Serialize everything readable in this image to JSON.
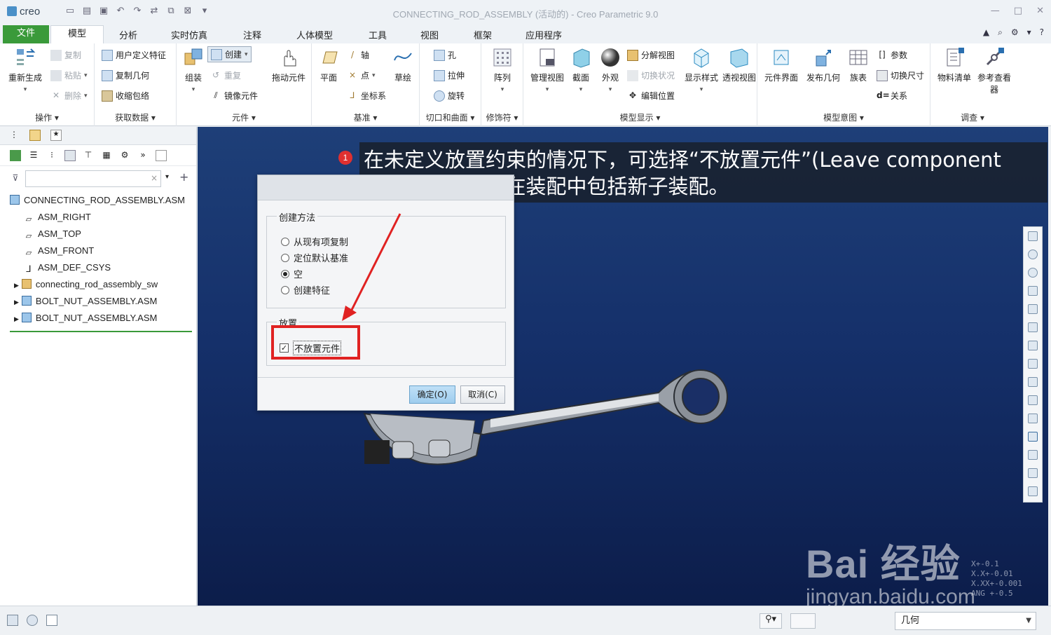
{
  "app": {
    "logo": "creo",
    "window_title": "CONNECTING_ROD_ASSEMBLY (活动的) - Creo Parametric 9.0"
  },
  "tabs": [
    "文件",
    "模型",
    "分析",
    "实时仿真",
    "注释",
    "人体模型",
    "工具",
    "视图",
    "框架",
    "应用程序"
  ],
  "ribbon": {
    "groups": {
      "operations": "操作",
      "get_data": "获取数据",
      "component": "元件",
      "datum": "基准",
      "cut_surface": "切口和曲面",
      "modifier": "修饰符",
      "model_display": "模型显示",
      "model_intent": "模型意图",
      "investigate": "调查"
    },
    "regenerate": "重新生成",
    "copy": "复制",
    "paste": "粘贴",
    "delete": "删除",
    "user_defined_feature": "用户定义特征",
    "copy_geometry": "复制几何",
    "shrinkwrap": "收缩包络",
    "assemble": "组装",
    "create": "创建",
    "repeat": "重复",
    "mirror_component": "镜像元件",
    "drag_components": "拖动元件",
    "plane": "平面",
    "axis": "轴",
    "point": "点",
    "csys": "坐标系",
    "sketch": "草绘",
    "hole": "孔",
    "extrude": "拉伸",
    "revolve": "旋转",
    "pattern": "阵列",
    "manage_views": "管理视图",
    "section": "截面",
    "appearance": "外观",
    "exploded_view": "分解视图",
    "toggle_status": "切换状况",
    "edit_position": "编辑位置",
    "display_style": "显示样式",
    "perspective_view": "透视视图",
    "component_interface": "元件界面",
    "publish_geometry": "发布几何",
    "family_table": "族表",
    "parameters": "参数",
    "switch_dimensions": "切换尺寸",
    "relations": "关系",
    "bill_of_materials": "物料清单",
    "reference_viewer": "参考查看器"
  },
  "model_tree": {
    "root": "CONNECTING_ROD_ASSEMBLY.ASM",
    "items": [
      "ASM_RIGHT",
      "ASM_TOP",
      "ASM_FRONT",
      "ASM_DEF_CSYS",
      "connecting_rod_assembly_sw",
      "BOLT_NUT_ASSEMBLY.ASM",
      "BOLT_NUT_ASSEMBLY.ASM"
    ]
  },
  "annotation": {
    "step": "1",
    "text": "在未定义放置约束的情况下，可选择“不放置元件”(Leave component unplaced)，以在装配中包括新子装配。"
  },
  "dialog": {
    "creation_method_label": "创建方法",
    "options": [
      "从现有项复制",
      "定位默认基准",
      "空",
      "创建特征"
    ],
    "selected_option": "空",
    "placement_label": "放置",
    "leave_unplaced_label": "不放置元件",
    "leave_unplaced_checked": true,
    "ok": "确定(O)",
    "cancel": "取消(C)"
  },
  "status": {
    "filter_value": "几何"
  },
  "watermark": {
    "brand": "Bai 经验",
    "url": "jingyan.baidu.com"
  },
  "tolerances": [
    "X+-0.1",
    "X.X+-0.01",
    "X.XX+-0.001",
    "ANG +-0.5"
  ],
  "colors": {
    "file_tab": "#3a9a3a",
    "viewport_top": "#1e3f78",
    "viewport_bottom": "#0c1d4a",
    "highlight_box": "#e02222"
  }
}
